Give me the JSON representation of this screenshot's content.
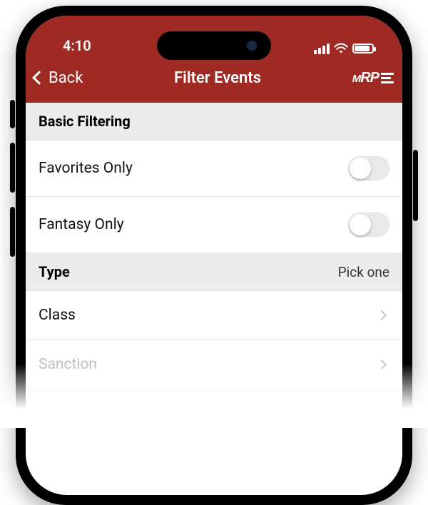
{
  "status": {
    "time": "4:10"
  },
  "nav": {
    "back_label": "Back",
    "title": "Filter Events",
    "logo_text": "MRP"
  },
  "sections": {
    "basic": {
      "header": "Basic Filtering",
      "favorites_label": "Favorites Only",
      "favorites_on": false,
      "fantasy_label": "Fantasy Only",
      "fantasy_on": false
    },
    "type": {
      "header": "Type",
      "hint": "Pick one",
      "class_label": "Class",
      "sanction_label": "Sanction"
    }
  }
}
